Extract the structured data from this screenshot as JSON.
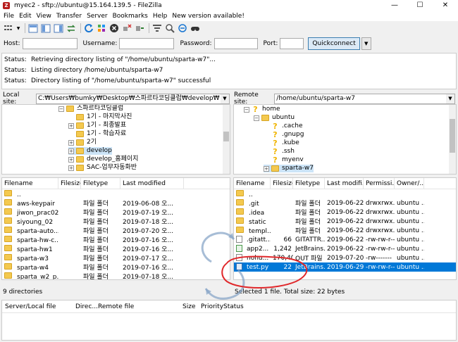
{
  "window": {
    "title": "myec2 - sftp://ubuntu@15.164.139.5 - FileZilla",
    "controls": [
      "—",
      "☐",
      "✕"
    ]
  },
  "menu": [
    "File",
    "Edit",
    "View",
    "Transfer",
    "Server",
    "Bookmarks",
    "Help",
    "New version available!"
  ],
  "quickconnect": {
    "host_label": "Host:",
    "username_label": "Username:",
    "password_label": "Password:",
    "port_label": "Port:",
    "button_label": "Quickconnect"
  },
  "log": [
    {
      "k": "Status:",
      "v": "Retrieving directory listing of \"/home/ubuntu/sparta-w7\"..."
    },
    {
      "k": "Status:",
      "v": "Listing directory /home/ubuntu/sparta-w7"
    },
    {
      "k": "Status:",
      "v": "Directory listing of \"/home/ubuntu/sparta-w7\" successful"
    }
  ],
  "local": {
    "site_label": "Local site:",
    "path": "C:₩Users₩bumky₩Desktop₩스파르타코딩클럽₩develop₩",
    "tree": [
      {
        "label": "스파르타코딩클럽",
        "pm": "−"
      },
      {
        "label": "1기 - 마지막사진",
        "pm": ""
      },
      {
        "label": "1기 - 최종발표",
        "pm": "+"
      },
      {
        "label": "1기 - 학습자료",
        "pm": ""
      },
      {
        "label": "2기",
        "pm": "+"
      },
      {
        "label": "develop",
        "pm": "+"
      },
      {
        "label": "develop_홈페이지",
        "pm": "+"
      },
      {
        "label": "SAC-업무자동화반",
        "pm": "+"
      }
    ],
    "headers": [
      "Filename",
      "Filesize",
      "Filetype",
      "Last modified"
    ],
    "files": [
      {
        "name": "..",
        "size": "",
        "type": "",
        "date": ""
      },
      {
        "name": "aws-keypair",
        "size": "",
        "type": "파일 폴더",
        "date": "2019-06-08 오..."
      },
      {
        "name": "jiwon_prac02",
        "size": "",
        "type": "파일 폴더",
        "date": "2019-07-19 오..."
      },
      {
        "name": "siyoung_02",
        "size": "",
        "type": "파일 폴더",
        "date": "2019-07-18 오..."
      },
      {
        "name": "sparta-auto...",
        "size": "",
        "type": "파일 폴더",
        "date": "2019-07-20 오..."
      },
      {
        "name": "sparta-hw-c...",
        "size": "",
        "type": "파일 폴더",
        "date": "2019-07-16 오..."
      },
      {
        "name": "sparta-hw1",
        "size": "",
        "type": "파일 폴더",
        "date": "2019-07-16 오..."
      },
      {
        "name": "sparta-w3",
        "size": "",
        "type": "파일 폴더",
        "date": "2019-07-17 오..."
      },
      {
        "name": "sparta-w4",
        "size": "",
        "type": "파일 폴더",
        "date": "2019-07-16 오..."
      },
      {
        "name": "sparta_w2_p...",
        "size": "",
        "type": "파일 폴더",
        "date": "2019-07-18 오..."
      }
    ],
    "status": "9 directories"
  },
  "remote": {
    "site_label": "Remote site:",
    "path": "/home/ubuntu/sparta-w7",
    "tree": [
      {
        "label": "home",
        "pm": "−",
        "icon": "q"
      },
      {
        "label": "ubuntu",
        "pm": "−",
        "icon": "folder"
      },
      {
        "label": ".cache",
        "pm": "",
        "icon": "q"
      },
      {
        "label": ".gnupg",
        "pm": "",
        "icon": "q"
      },
      {
        "label": ".kube",
        "pm": "",
        "icon": "q"
      },
      {
        "label": ".ssh",
        "pm": "",
        "icon": "q"
      },
      {
        "label": "myenv",
        "pm": "",
        "icon": "q"
      },
      {
        "label": "sparta-w7",
        "pm": "+",
        "icon": "folder"
      }
    ],
    "headers": [
      "Filename",
      "Filesize",
      "Filetype",
      "Last modifi...",
      "Permissi...",
      "Owner/..."
    ],
    "files": [
      {
        "name": "..",
        "size": "",
        "type": "",
        "date": "",
        "perm": "",
        "owner": "",
        "icon": "folder"
      },
      {
        "name": ".git",
        "size": "",
        "type": "파일 폴더",
        "date": "2019-06-22...",
        "perm": "drwxrwx...",
        "owner": "ubuntu ...",
        "icon": "folder"
      },
      {
        "name": ".idea",
        "size": "",
        "type": "파일 폴더",
        "date": "2019-06-22...",
        "perm": "drwxrwx...",
        "owner": "ubuntu ...",
        "icon": "folder"
      },
      {
        "name": "static",
        "size": "",
        "type": "파일 폴더",
        "date": "2019-06-22...",
        "perm": "drwxrwx...",
        "owner": "ubuntu ...",
        "icon": "folder"
      },
      {
        "name": "templ...",
        "size": "",
        "type": "파일 폴더",
        "date": "2019-06-22...",
        "perm": "drwxrwx...",
        "owner": "ubuntu ...",
        "icon": "folder"
      },
      {
        "name": ".gitatt...",
        "size": "66",
        "type": "GITATTR...",
        "date": "2019-06-22...",
        "perm": "-rw-rw-r--",
        "owner": "ubuntu ...",
        "icon": "file"
      },
      {
        "name": "app2...",
        "size": "1,242",
        "type": "JetBrains...",
        "date": "2019-06-22...",
        "perm": "-rw-rw-r--",
        "owner": "ubuntu ...",
        "icon": "java"
      },
      {
        "name": "nohu...",
        "size": "170,406",
        "type": "OUT 파일",
        "date": "2019-07-20...",
        "perm": "-rw-------",
        "owner": "ubuntu ...",
        "icon": "file"
      },
      {
        "name": "test.py",
        "size": "22",
        "type": "JetBrains...",
        "date": "2019-06-29...",
        "perm": "-rw-rw-r--",
        "owner": "ubuntu ...",
        "icon": "py",
        "selected": true
      }
    ],
    "status": "Selected 1 file. Total size: 22 bytes"
  },
  "queue": {
    "headers": [
      "Server/Local file",
      "Direc...",
      "Remote file",
      "Size",
      "Priority",
      "Status"
    ]
  }
}
